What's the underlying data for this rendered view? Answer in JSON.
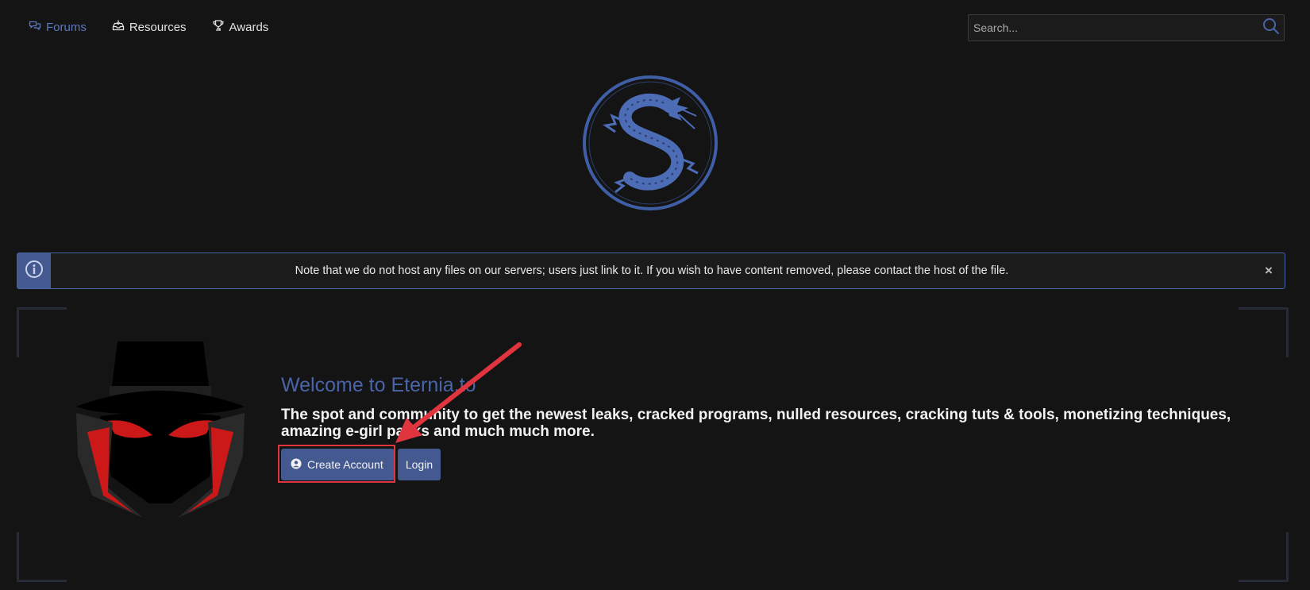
{
  "nav": {
    "items": [
      {
        "label": "Forums",
        "icon": "chat-bubbles-icon",
        "active": true
      },
      {
        "label": "Resources",
        "icon": "inbox-icon",
        "active": false
      },
      {
        "label": "Awards",
        "icon": "trophy-icon",
        "active": false
      }
    ]
  },
  "search": {
    "placeholder": "Search..."
  },
  "notice": {
    "text": "Note that we do not host any files on our servers; users just link to it. If you wish to have content removed, please contact the host of the file.",
    "close_label": "×"
  },
  "welcome": {
    "title": "Welcome to Eternia.to",
    "text": "The spot and community to get the newest leaks, cracked programs, nulled resources, cracking tuts & tools, monetizing techniques, amazing e-girl packs and much much more.",
    "create_label": "Create Account",
    "login_label": "Login"
  },
  "colors": {
    "accent": "#4a64a8",
    "button": "#44598f",
    "background": "#141414",
    "annotation": "#e0343f"
  }
}
